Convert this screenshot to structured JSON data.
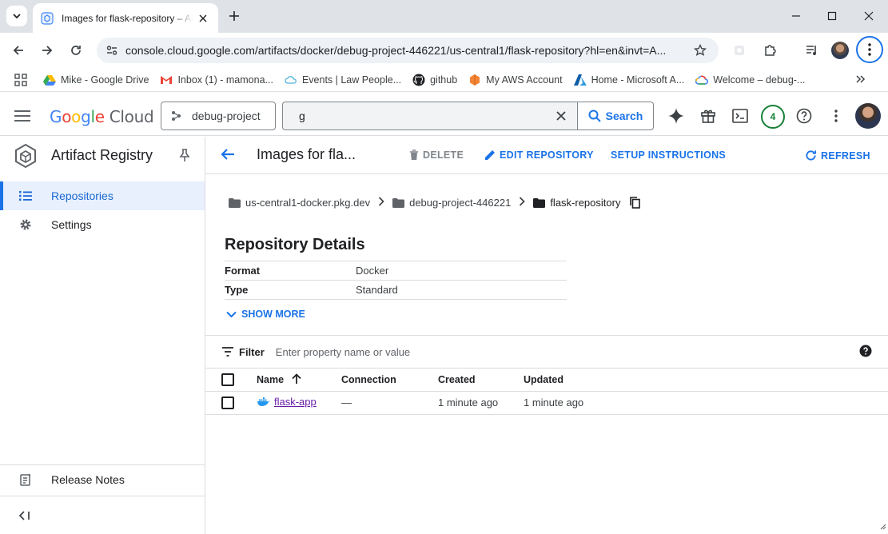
{
  "browser": {
    "tab_title": "Images for flask-repository – Artifact Registry",
    "url": "console.cloud.google.com/artifacts/docker/debug-project-446221/us-central1/flask-repository?hl=en&invt=A...",
    "bookmarks": [
      {
        "label": "Mike - Google Drive",
        "icon": "google-drive-icon"
      },
      {
        "label": "Inbox (1) - mamona...",
        "icon": "gmail-icon"
      },
      {
        "label": "Events | Law People...",
        "icon": "cloud-icon"
      },
      {
        "label": "github",
        "icon": "github-icon"
      },
      {
        "label": "My AWS Account",
        "icon": "aws-icon"
      },
      {
        "label": "Home - Microsoft A...",
        "icon": "azure-icon"
      },
      {
        "label": "Welcome – debug-...",
        "icon": "gcp-icon"
      }
    ]
  },
  "header": {
    "logo_google": "Google",
    "logo_cloud": "Cloud",
    "project": "debug-project",
    "search_value": "g",
    "search_button": "Search",
    "notifications_count": "4"
  },
  "leftnav": {
    "title": "Artifact Registry",
    "items": [
      {
        "label": "Repositories",
        "active": true
      },
      {
        "label": "Settings",
        "active": false
      }
    ],
    "bottom_item": "Release Notes"
  },
  "main": {
    "title": "Images for fla...",
    "actions": {
      "delete": "DELETE",
      "edit": "EDIT REPOSITORY",
      "setup": "SETUP INSTRUCTIONS",
      "refresh": "REFRESH"
    },
    "breadcrumbs": [
      "us-central1-docker.pkg.dev",
      "debug-project-446221",
      "flask-repository"
    ],
    "details_title": "Repository Details",
    "details": [
      {
        "key": "Format",
        "value": "Docker"
      },
      {
        "key": "Type",
        "value": "Standard"
      }
    ],
    "show_more": "SHOW MORE",
    "filter_label": "Filter",
    "filter_placeholder": "Enter property name or value",
    "table": {
      "columns": [
        "Name",
        "Connection",
        "Created",
        "Updated"
      ],
      "rows": [
        {
          "name": "flask-app",
          "connection": "—",
          "created": "1 minute ago",
          "updated": "1 minute ago"
        }
      ]
    }
  },
  "colors": {
    "accent": "#1a73e8",
    "active_bg": "#e8f0fe",
    "link_visited": "#681da8"
  }
}
